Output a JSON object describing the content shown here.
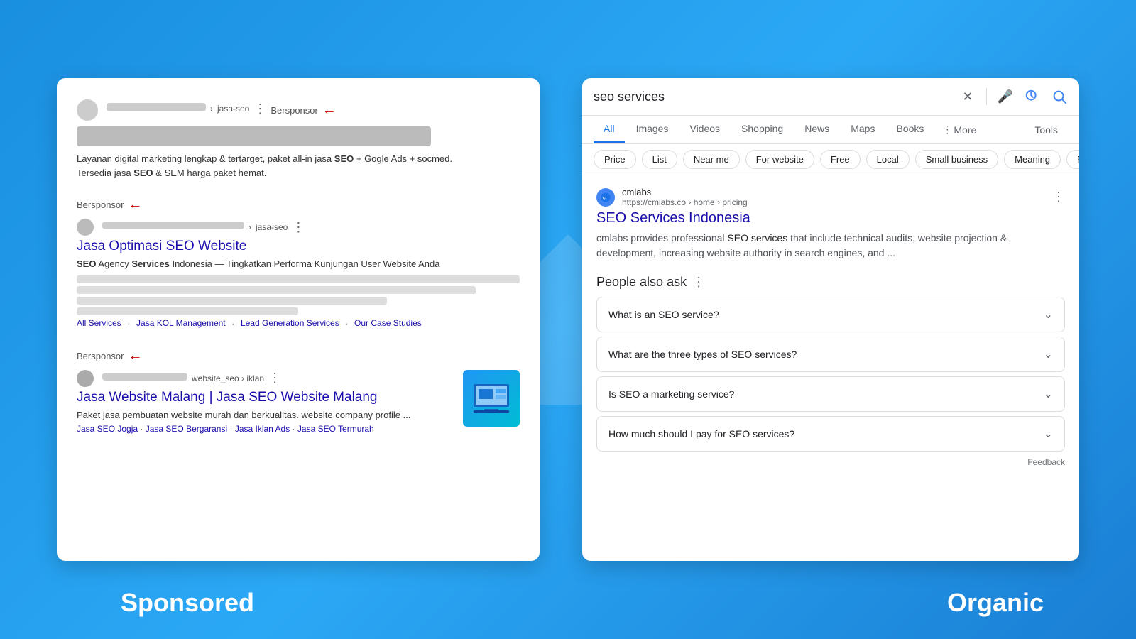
{
  "background": {
    "color": "#1a8fe0"
  },
  "left_panel": {
    "label": "Sponsored",
    "ads": [
      {
        "type": "ad1",
        "bersponsor": "Bersponsor",
        "url_short": "w... › jasa-seo",
        "description": "Layanan digital marketing lengkap & tertarget, paket all-in jasa SEO + Gogle Ads + socmed. Tersedia jasa SEO & SEM harga paket hemat.",
        "seo_bold": "SEO",
        "sem_bold": "SEO"
      },
      {
        "type": "ad2",
        "bersponsor": "Bersponsor",
        "url_short": "v... › jasa-seo",
        "title": "Jasa Optimasi SEO Website",
        "description_parts": [
          "SEO",
          " Agency ",
          "Services",
          " Indonesia — Tingkatkan Performa Kunjungan User Website Anda"
        ],
        "links": [
          "All Services",
          "Jasa KOL Management",
          "Lead Generation Services",
          "Our Case Studies"
        ]
      },
      {
        "type": "ad3",
        "bersponsor": "Bersponsor",
        "url_short": "website_seo › iklan",
        "title": "Jasa Website Malang | Jasa SEO Website Malang",
        "description": "Paket jasa pembuatan website murah dan berkualitas. website company profile ... Jasa SEO Jogja · Jasa SEO Bergaransi · Jasa Iklan Ads · Jasa SEO Termurah",
        "sub_links": [
          "Jasa SEO Jogja",
          "Jasa SEO Bergaransi",
          "Jasa Iklan Ads",
          "Jasa SEO Termurah"
        ]
      }
    ]
  },
  "right_panel": {
    "label": "Organic",
    "search_bar": {
      "query": "seo services",
      "placeholder": "seo services"
    },
    "tabs": [
      {
        "label": "All",
        "active": true
      },
      {
        "label": "Images",
        "active": false
      },
      {
        "label": "Videos",
        "active": false
      },
      {
        "label": "Shopping",
        "active": false
      },
      {
        "label": "News",
        "active": false
      },
      {
        "label": "Maps",
        "active": false
      },
      {
        "label": "Books",
        "active": false
      },
      {
        "label": "More",
        "active": false
      }
    ],
    "tools_label": "Tools",
    "filter_pills": [
      "Price",
      "List",
      "Near me",
      "For website",
      "Free",
      "Local",
      "Small business",
      "Meaning",
      "Fiver..."
    ],
    "top_result": {
      "site_name": "cmlabs",
      "site_url": "https://cmlabs.co › home › pricing",
      "title": "SEO Services Indonesia",
      "description": "cmlabs provides professional SEO services that include technical audits, website projection & development, increasing website authority in search engines, and ..."
    },
    "people_also_ask": {
      "heading": "People also ask",
      "questions": [
        "What is an SEO service?",
        "What are the three types of SEO services?",
        "Is SEO a marketing service?",
        "How much should I pay for SEO services?"
      ]
    },
    "feedback": "Feedback"
  }
}
